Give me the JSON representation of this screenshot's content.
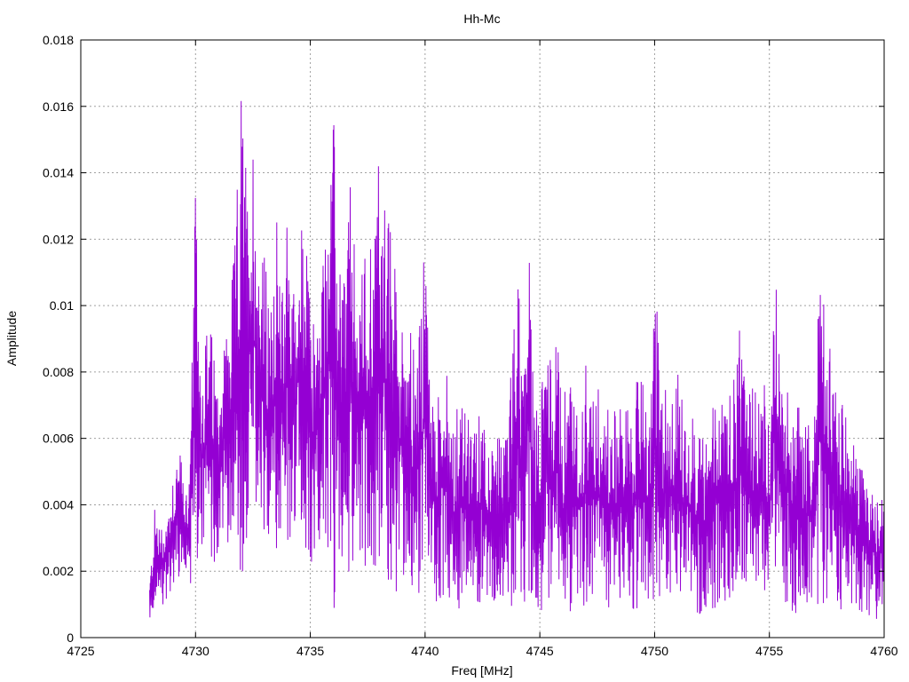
{
  "chart_data": {
    "type": "line",
    "title": "Hh-Mc",
    "xlabel": "Freq [MHz]",
    "ylabel": "Amplitude",
    "xlim": [
      4725,
      4760
    ],
    "ylim": [
      0,
      0.018
    ],
    "x_ticks": [
      "4725",
      "4730",
      "4735",
      "4740",
      "4745",
      "4750",
      "4755",
      "4760"
    ],
    "y_ticks": [
      "0",
      "0.002",
      "0.004",
      "0.006",
      "0.008",
      "0.01",
      "0.012",
      "0.014",
      "0.016",
      "0.018"
    ],
    "grid": true,
    "series": [
      {
        "color": "#9400d3",
        "x": [
          4728.0,
          4728.25,
          4728.5,
          4728.75,
          4729.0,
          4729.25,
          4729.5,
          4729.75,
          4730.0,
          4730.25,
          4730.5,
          4730.75,
          4731.0,
          4731.25,
          4731.5,
          4731.75,
          4732.0,
          4732.25,
          4732.5,
          4732.75,
          4733.0,
          4733.25,
          4733.5,
          4733.75,
          4734.0,
          4734.25,
          4734.5,
          4734.75,
          4735.0,
          4735.25,
          4735.5,
          4735.75,
          4736.0,
          4736.25,
          4736.5,
          4736.75,
          4737.0,
          4737.25,
          4737.5,
          4737.75,
          4738.0,
          4738.25,
          4738.5,
          4738.75,
          4739.0,
          4739.25,
          4739.5,
          4739.75,
          4740.0,
          4740.25,
          4740.5,
          4740.75,
          4741.0,
          4741.25,
          4741.5,
          4741.75,
          4742.0,
          4742.25,
          4742.5,
          4742.75,
          4743.0,
          4743.25,
          4743.5,
          4743.75,
          4744.0,
          4744.25,
          4744.5,
          4744.75,
          4745.0,
          4745.25,
          4745.5,
          4745.75,
          4746.0,
          4746.25,
          4746.5,
          4746.75,
          4747.0,
          4747.25,
          4747.5,
          4747.75,
          4748.0,
          4748.25,
          4748.5,
          4748.75,
          4749.0,
          4749.25,
          4749.5,
          4749.75,
          4750.0,
          4750.25,
          4750.5,
          4750.75,
          4751.0,
          4751.25,
          4751.5,
          4751.75,
          4752.0,
          4752.25,
          4752.5,
          4752.75,
          4753.0,
          4753.25,
          4753.5,
          4753.75,
          4754.0,
          4754.25,
          4754.5,
          4754.75,
          4755.0,
          4755.25,
          4755.5,
          4755.75,
          4756.0,
          4756.25,
          4756.5,
          4756.75,
          4757.0,
          4757.25,
          4757.5,
          4757.75,
          4758.0,
          4758.25,
          4758.5,
          4758.75,
          4759.0,
          4759.25,
          4759.5,
          4759.75,
          4760.0
        ],
        "lo": [
          0.0006,
          0.0008,
          0.0009,
          0.0012,
          0.0014,
          0.0016,
          0.0018,
          0.0015,
          0.0025,
          0.002,
          0.0022,
          0.0019,
          0.0025,
          0.003,
          0.0028,
          0.0034,
          0.0006,
          0.003,
          0.0028,
          0.0036,
          0.002,
          0.0029,
          0.0026,
          0.0032,
          0.0021,
          0.0028,
          0.0035,
          0.0026,
          0.0018,
          0.0026,
          0.0024,
          0.0022,
          0.0006,
          0.0026,
          0.0023,
          0.0018,
          0.0028,
          0.0024,
          0.0017,
          0.0022,
          0.0021,
          0.0019,
          0.0012,
          0.0014,
          0.0018,
          0.0016,
          0.0009,
          0.0013,
          0.0012,
          0.0011,
          0.001,
          0.0013,
          0.0012,
          0.0009,
          0.0006,
          0.0011,
          0.0012,
          0.0009,
          0.0012,
          0.0013,
          0.0011,
          0.0012,
          0.0009,
          0.0008,
          0.0012,
          0.001,
          0.0011,
          0.0012,
          0.0008,
          0.0009,
          0.0012,
          0.0011,
          0.0009,
          0.0006,
          0.0008,
          0.0011,
          0.0009,
          0.0012,
          0.0009,
          0.0008,
          0.0009,
          0.0012,
          0.001,
          0.0011,
          0.0009,
          0.0008,
          0.0011,
          0.001,
          0.0012,
          0.0011,
          0.0009,
          0.0012,
          0.0011,
          0.0009,
          0.001,
          0.0008,
          0.0007,
          0.0009,
          0.0004,
          0.0009,
          0.0011,
          0.001,
          0.0012,
          0.0009,
          0.0011,
          0.0012,
          0.001,
          0.0011,
          0.0009,
          0.0011,
          0.0012,
          0.0009,
          0.0008,
          0.0007,
          0.0009,
          0.0008,
          0.0011,
          0.0009,
          0.001,
          0.0011,
          0.0009,
          0.0008,
          0.001,
          0.0009,
          0.0008,
          0.0006,
          0.0007,
          0.0005,
          0.0008
        ],
        "hi": [
          0.0017,
          0.0042,
          0.0034,
          0.0038,
          0.0052,
          0.006,
          0.0046,
          0.0052,
          0.0136,
          0.0086,
          0.0096,
          0.0092,
          0.0078,
          0.0094,
          0.0098,
          0.0124,
          0.0172,
          0.0138,
          0.0156,
          0.0122,
          0.0118,
          0.0096,
          0.0132,
          0.0102,
          0.0142,
          0.0106,
          0.0122,
          0.0128,
          0.0101,
          0.0098,
          0.0112,
          0.0142,
          0.0161,
          0.0112,
          0.0118,
          0.0142,
          0.0106,
          0.0112,
          0.0128,
          0.0122,
          0.0152,
          0.0136,
          0.0124,
          0.0112,
          0.0096,
          0.0108,
          0.0088,
          0.0092,
          0.0121,
          0.0076,
          0.0071,
          0.0082,
          0.0078,
          0.0066,
          0.0071,
          0.0072,
          0.0061,
          0.0065,
          0.0074,
          0.0061,
          0.0055,
          0.0064,
          0.0062,
          0.0082,
          0.0123,
          0.0078,
          0.013,
          0.0068,
          0.0072,
          0.0104,
          0.0082,
          0.0091,
          0.0064,
          0.0095,
          0.0072,
          0.0066,
          0.0082,
          0.0076,
          0.0078,
          0.0075,
          0.0071,
          0.0068,
          0.0072,
          0.0073,
          0.0065,
          0.0079,
          0.0076,
          0.0061,
          0.0116,
          0.0074,
          0.0079,
          0.0073,
          0.0081,
          0.0072,
          0.0069,
          0.0066,
          0.0063,
          0.0062,
          0.0071,
          0.0082,
          0.0076,
          0.0072,
          0.0079,
          0.0096,
          0.0071,
          0.0075,
          0.0078,
          0.0081,
          0.0062,
          0.0122,
          0.0074,
          0.0082,
          0.0071,
          0.0073,
          0.0068,
          0.0065,
          0.0072,
          0.0122,
          0.0096,
          0.0082,
          0.0074,
          0.0071,
          0.0062,
          0.0056,
          0.0055,
          0.0049,
          0.0046,
          0.0042,
          0.005
        ]
      }
    ]
  }
}
